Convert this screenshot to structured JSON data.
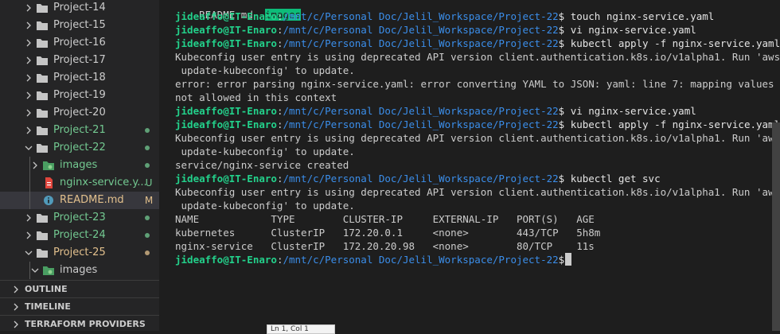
{
  "explorer": {
    "items": [
      {
        "label": "Project-14",
        "kind": "folder",
        "state": "collapsed",
        "color": "#cccccc",
        "status": ""
      },
      {
        "label": "Project-15",
        "kind": "folder",
        "state": "collapsed",
        "color": "#cccccc",
        "status": ""
      },
      {
        "label": "Project-16",
        "kind": "folder",
        "state": "collapsed",
        "color": "#cccccc",
        "status": ""
      },
      {
        "label": "Project-17",
        "kind": "folder",
        "state": "collapsed",
        "color": "#cccccc",
        "status": ""
      },
      {
        "label": "Project-18",
        "kind": "folder",
        "state": "collapsed",
        "color": "#cccccc",
        "status": ""
      },
      {
        "label": "Project-19",
        "kind": "folder",
        "state": "collapsed",
        "color": "#cccccc",
        "status": ""
      },
      {
        "label": "Project-20",
        "kind": "folder",
        "state": "collapsed",
        "color": "#cccccc",
        "status": ""
      },
      {
        "label": "Project-21",
        "kind": "folder",
        "state": "collapsed",
        "color": "#73c991",
        "status": "dot",
        "status_color": "#73c991"
      },
      {
        "label": "Project-22",
        "kind": "folder",
        "state": "expanded",
        "color": "#73c991",
        "status": "dot",
        "status_color": "#73c991"
      },
      {
        "label": "images",
        "kind": "image-folder",
        "state": "collapsed",
        "color": "#73c991",
        "status": "dot",
        "status_color": "#73c991"
      },
      {
        "label": "nginx-service.y...",
        "kind": "file-yaml",
        "state": "",
        "color": "#73c991",
        "status": "U",
        "status_color": "#73c991"
      },
      {
        "label": "README.md",
        "kind": "file-info",
        "state": "",
        "color": "#e2c08d",
        "status": "M",
        "status_color": "#e2c08d"
      },
      {
        "label": "Project-23",
        "kind": "folder",
        "state": "collapsed",
        "color": "#73c991",
        "status": "dot",
        "status_color": "#73c991"
      },
      {
        "label": "Project-24",
        "kind": "folder",
        "state": "collapsed",
        "color": "#73c991",
        "status": "dot",
        "status_color": "#73c991"
      },
      {
        "label": "Project-25",
        "kind": "folder",
        "state": "expanded",
        "color": "#e2c08d",
        "status": "dot",
        "status_color": "#e2c08d"
      },
      {
        "label": "images",
        "kind": "image-folder",
        "state": "expanded",
        "color": "#cccccc",
        "status": "",
        "status_color": ""
      }
    ],
    "sections": [
      {
        "label": "OUTLINE"
      },
      {
        "label": "TIMELINE"
      },
      {
        "label": "TERRAFORM PROVIDERS"
      }
    ]
  },
  "terminal": {
    "top_line": {
      "file": "README.md",
      "highlighted": "images"
    },
    "prompt": {
      "user": "jideaffo@IT-Enaro",
      "path": "/mnt/c/Personal Doc/Jelil_Workspace/Project-22"
    },
    "lines": [
      {
        "type": "prompt",
        "cmd": "touch nginx-service.yaml"
      },
      {
        "type": "prompt",
        "cmd": "vi nginx-service.yaml"
      },
      {
        "type": "prompt",
        "cmd": "kubectl apply -f nginx-service.yaml"
      },
      {
        "type": "out",
        "text": "Kubeconfig user entry is using deprecated API version client.authentication.k8s.io/v1alpha1. Run 'aws eks"
      },
      {
        "type": "out",
        "text": " update-kubeconfig' to update."
      },
      {
        "type": "out",
        "text": "error: error parsing nginx-service.yaml: error converting YAML to JSON: yaml: line 7: mapping values are"
      },
      {
        "type": "out",
        "text": "not allowed in this context"
      },
      {
        "type": "prompt",
        "cmd": "vi nginx-service.yaml"
      },
      {
        "type": "prompt",
        "cmd": "kubectl apply -f nginx-service.yaml"
      },
      {
        "type": "out",
        "text": "Kubeconfig user entry is using deprecated API version client.authentication.k8s.io/v1alpha1. Run 'aws eks"
      },
      {
        "type": "out",
        "text": " update-kubeconfig' to update."
      },
      {
        "type": "out",
        "text": "service/nginx-service created"
      },
      {
        "type": "prompt",
        "cmd": "kubectl get svc"
      },
      {
        "type": "out",
        "text": "Kubeconfig user entry is using deprecated API version client.authentication.k8s.io/v1alpha1. Run 'aws eks"
      },
      {
        "type": "out",
        "text": " update-kubeconfig' to update."
      },
      {
        "type": "out",
        "text": "NAME            TYPE        CLUSTER-IP     EXTERNAL-IP   PORT(S)   AGE"
      },
      {
        "type": "out",
        "text": "kubernetes      ClusterIP   172.20.0.1     <none>        443/TCP   5h8m"
      },
      {
        "type": "out",
        "text": "nginx-service   ClusterIP   172.20.20.98   <none>        80/TCP    11s"
      },
      {
        "type": "prompt-cursor",
        "cmd": ""
      }
    ]
  },
  "tooltip": {
    "text": "Ln 1, Col 1"
  }
}
